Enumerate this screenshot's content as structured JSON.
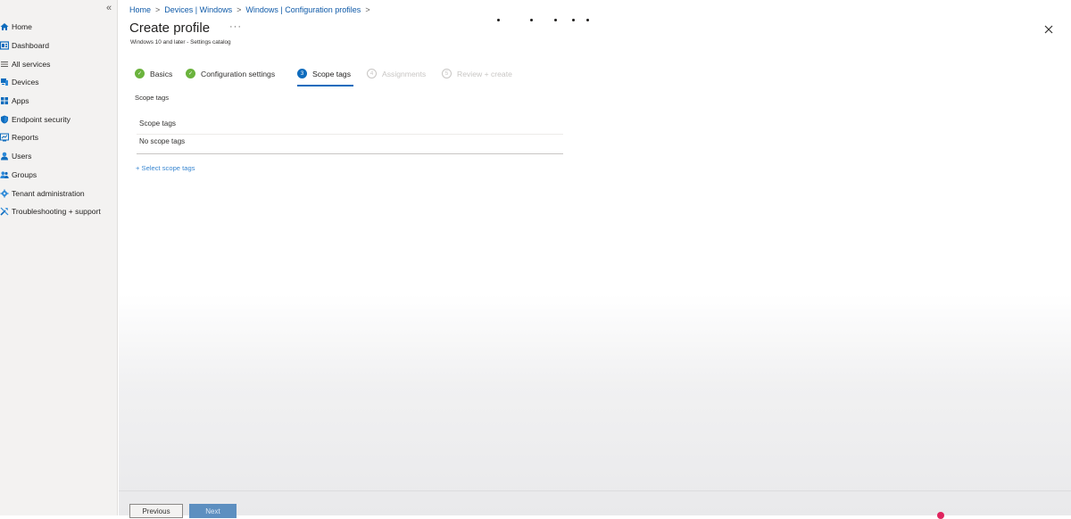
{
  "sidebar": {
    "collapse_icon": "«",
    "items": [
      {
        "label": "Home",
        "icon": "home-icon"
      },
      {
        "label": "Dashboard",
        "icon": "dashboard-icon"
      },
      {
        "label": "All services",
        "icon": "list-icon"
      },
      {
        "label": "Devices",
        "icon": "devices-icon"
      },
      {
        "label": "Apps",
        "icon": "apps-icon"
      },
      {
        "label": "Endpoint security",
        "icon": "shield-icon"
      },
      {
        "label": "Reports",
        "icon": "reports-icon"
      },
      {
        "label": "Users",
        "icon": "user-icon"
      },
      {
        "label": "Groups",
        "icon": "groups-icon"
      },
      {
        "label": "Tenant administration",
        "icon": "gear-icon"
      },
      {
        "label": "Troubleshooting + support",
        "icon": "wrench-icon"
      }
    ]
  },
  "breadcrumb": [
    "Home",
    "Devices | Windows",
    "Windows | Configuration profiles"
  ],
  "page": {
    "title": "Create profile",
    "more": "···",
    "subtitle": "Windows 10 and later - Settings catalog"
  },
  "steps": [
    {
      "label": "Basics",
      "state": "done",
      "marker": "✓"
    },
    {
      "label": "Configuration settings",
      "state": "done",
      "marker": "✓"
    },
    {
      "label": "Scope tags",
      "state": "active",
      "marker": "3"
    },
    {
      "label": "Assignments",
      "state": "future",
      "marker": "4"
    },
    {
      "label": "Review + create",
      "state": "future",
      "marker": "5"
    }
  ],
  "scope": {
    "section_label": "Scope tags",
    "column_header": "Scope tags",
    "empty_text": "No scope tags",
    "select_link": "+ Select scope tags"
  },
  "footer": {
    "previous_label": "Previous",
    "next_label": "Next"
  },
  "colors": {
    "accent": "#0f6cbd",
    "done": "#6bb33d",
    "link": "#0f5aa8"
  }
}
